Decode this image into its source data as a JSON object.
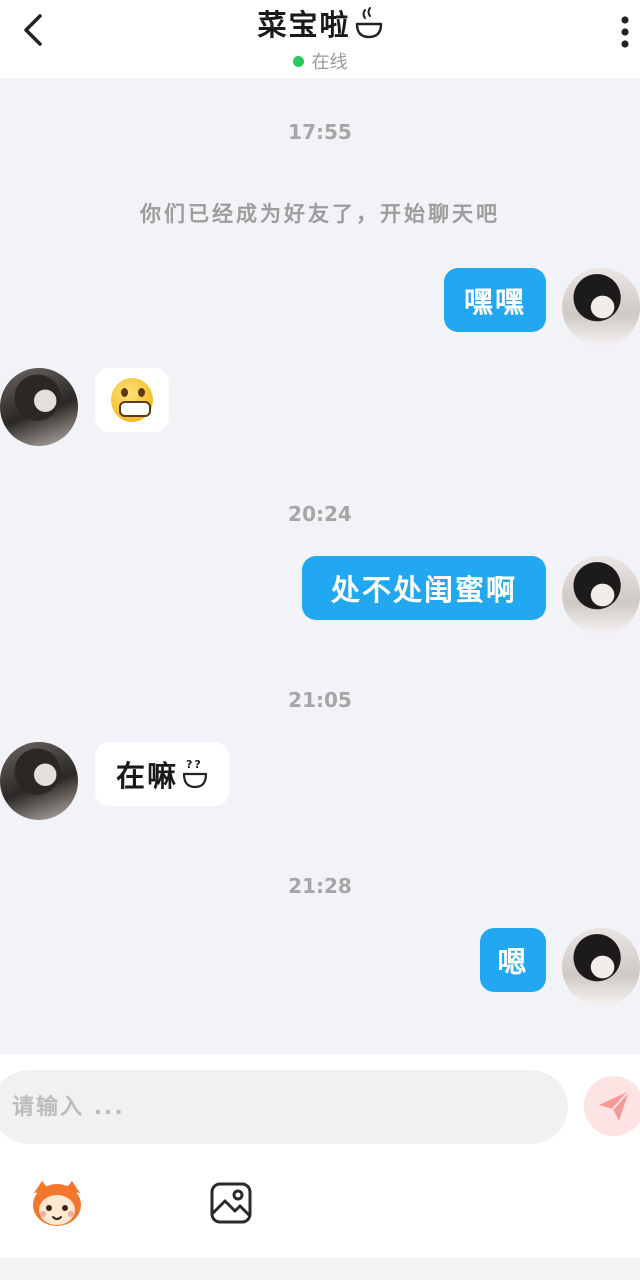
{
  "header": {
    "title": "菜宝啦",
    "status_text": "在线"
  },
  "chat": {
    "system_message": "你们已经成为好友了，开始聊天吧",
    "timestamps": [
      "17:55",
      "20:24",
      "21:05",
      "21:28"
    ],
    "messages": [
      {
        "sender": "me",
        "text": "嘿嘿"
      },
      {
        "sender": "friend",
        "emoji": "grinning-face"
      },
      {
        "sender": "me",
        "text": "处不处闺蜜啊"
      },
      {
        "sender": "friend",
        "text": "在嘛"
      },
      {
        "sender": "me",
        "text": "嗯"
      }
    ]
  },
  "composer": {
    "placeholder": "请输入 ..."
  },
  "colors": {
    "outgoing_bubble": "#22a8f1",
    "incoming_bubble": "#ffffff",
    "online_dot": "#2cc95c",
    "send_button_bg": "#fde3e3",
    "send_icon": "#f49a9a"
  }
}
